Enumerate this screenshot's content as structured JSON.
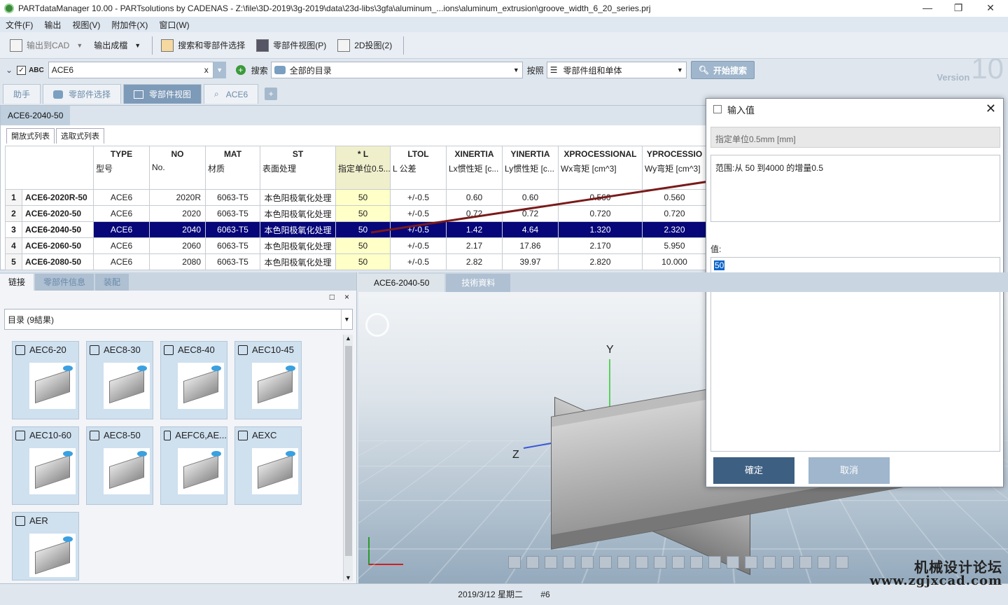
{
  "window": {
    "title": "PARTdataManager 10.00 - PARTsolutions by CADENAS - Z:\\file\\3D-2019\\3g-2019\\data\\23d-libs\\3gfa\\aluminum_...ions\\aluminum_extrusion\\groove_width_6_20_series.prj"
  },
  "menu": [
    "文件(F)",
    "输出",
    "视图(V)",
    "附加件(X)",
    "窗口(W)"
  ],
  "toolbar": {
    "export_cad": "输出到CAD",
    "export_file": "输出成檔",
    "search_select": "搜索和零部件选择",
    "part_view": "零部件视图(P)",
    "projection_2d": "2D投图(2)"
  },
  "search": {
    "abc": "ABC",
    "query": "ACE6",
    "clear": "x",
    "search_label": "搜索",
    "scope": "全部的目录",
    "by_label": "按照",
    "by_value": "零部件组和单体",
    "start": "开始搜索"
  },
  "version": {
    "word": "Version",
    "number": "10"
  },
  "tabs": [
    "助手",
    "零部件选择",
    "零部件视图",
    "ACE6"
  ],
  "tab_add": "+",
  "table_panel": {
    "title": "ACE6-2040-50",
    "subtabs": [
      "開放式列表",
      "选取式列表"
    ]
  },
  "table": {
    "columns": [
      {
        "code": "",
        "desc": ""
      },
      {
        "code": "TYPE",
        "desc": "型号"
      },
      {
        "code": "NO",
        "desc": "No."
      },
      {
        "code": "MAT",
        "desc": "材质"
      },
      {
        "code": "ST",
        "desc": "表面处理"
      },
      {
        "code": "* L",
        "desc": "指定单位0.5..."
      },
      {
        "code": "LTOL",
        "desc": "L 公差"
      },
      {
        "code": "XINERTIA",
        "desc": "Lx惯性矩 [c..."
      },
      {
        "code": "YINERTIA",
        "desc": "Ly惯性矩 [c..."
      },
      {
        "code": "XPROCESSIONAL",
        "desc": "Wx弯矩 [cm^3]"
      },
      {
        "code": "YPROCESSIO",
        "desc": "Wy弯矩 [cm^3]"
      }
    ],
    "rows": [
      {
        "n": "1",
        "name": "ACE6-2020R-50",
        "type": "ACE6",
        "no": "2020R",
        "mat": "6063-T5",
        "st": "本色阳极氧化处理",
        "l": "50",
        "ltol": "+/-0.5",
        "xi": "0.60",
        "yi": "0.60",
        "xp": "0.560",
        "yp": "0.560"
      },
      {
        "n": "2",
        "name": "ACE6-2020-50",
        "type": "ACE6",
        "no": "2020",
        "mat": "6063-T5",
        "st": "本色阳极氧化处理",
        "l": "50",
        "ltol": "+/-0.5",
        "xi": "0.72",
        "yi": "0.72",
        "xp": "0.720",
        "yp": "0.720"
      },
      {
        "n": "3",
        "name": "ACE6-2040-50",
        "type": "ACE6",
        "no": "2040",
        "mat": "6063-T5",
        "st": "本色阳极氧化处理",
        "l": "50",
        "ltol": "+/-0.5",
        "xi": "1.42",
        "yi": "4.64",
        "xp": "1.320",
        "yp": "2.320"
      },
      {
        "n": "4",
        "name": "ACE6-2060-50",
        "type": "ACE6",
        "no": "2060",
        "mat": "6063-T5",
        "st": "本色阳极氧化处理",
        "l": "50",
        "ltol": "+/-0.5",
        "xi": "2.17",
        "yi": "17.86",
        "xp": "2.170",
        "yp": "5.950"
      },
      {
        "n": "5",
        "name": "ACE6-2080-50",
        "type": "ACE6",
        "no": "2080",
        "mat": "6063-T5",
        "st": "本色阳极氧化处理",
        "l": "50",
        "ltol": "+/-0.5",
        "xi": "2.82",
        "yi": "39.97",
        "xp": "2.820",
        "yp": "10.000"
      }
    ]
  },
  "left_panel": {
    "tabs": [
      "链接",
      "零部件信息",
      "装配"
    ],
    "catalog": "目录 (9結果)",
    "maximize": "□",
    "close": "×"
  },
  "thumbnails": [
    "AEC6-20",
    "AEC8-30",
    "AEC8-40",
    "AEC10-45",
    "AEC10-60",
    "AEC8-50",
    "AEFC6,AE...",
    "AEXC",
    "AER"
  ],
  "viewer": {
    "tabs": [
      "ACE6-2040-50",
      "技術資料"
    ],
    "axis_y": "Y",
    "axis_z": "Z"
  },
  "status": {
    "date": "2019/3/12 星期二",
    "num": "#6"
  },
  "dialog": {
    "title": "输入值",
    "hint": "指定单位0.5mm [mm]",
    "range": "范围:从 50 到4000 的增量0.5",
    "value_label": "值:",
    "value": "50",
    "ok": "確定",
    "cancel": "取消",
    "close": "✕"
  },
  "watermark": {
    "line1": "机械设计论坛",
    "line2": "www.zgjxcad.com"
  },
  "colors": {
    "selection": "#07077a",
    "accent": "#7d9ab8",
    "dialog_btn_ok": "#3d5f82",
    "dialog_btn_cancel": "#9fb6cc",
    "highlight_column": "#ffffc8"
  }
}
